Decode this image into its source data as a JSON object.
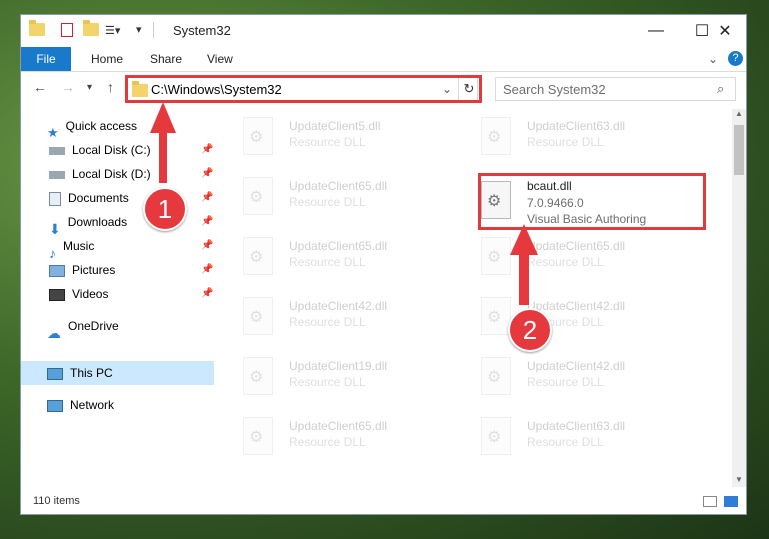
{
  "window": {
    "title": "System32"
  },
  "ribbon": {
    "tabs": [
      "File",
      "Home",
      "Share",
      "View"
    ]
  },
  "address": {
    "path": "C:\\Windows\\System32"
  },
  "search": {
    "placeholder": "Search System32"
  },
  "sidebar": {
    "quick_access": "Quick access",
    "items": [
      {
        "label": "Local Disk (C:)",
        "icon": "drive-icon"
      },
      {
        "label": "Local Disk (D:)",
        "icon": "drive-icon"
      },
      {
        "label": "Documents",
        "icon": "documents-icon"
      },
      {
        "label": "Downloads",
        "icon": "downloads-icon"
      },
      {
        "label": "Music",
        "icon": "music-icon"
      },
      {
        "label": "Pictures",
        "icon": "pictures-icon"
      },
      {
        "label": "Videos",
        "icon": "videos-icon"
      }
    ],
    "onedrive": "OneDrive",
    "this_pc": "This PC",
    "network": "Network"
  },
  "files": {
    "background": [
      {
        "name": "UpdateClient5.dll",
        "desc": "Resource DLL"
      },
      {
        "name": "UpdateClient65.dll",
        "desc": "Resource DLL"
      },
      {
        "name": "UpdateClient65.dll",
        "desc": "Resource DLL"
      },
      {
        "name": "UpdateClient42.dll",
        "desc": "Resource DLL"
      },
      {
        "name": "UpdateClient19.dll",
        "desc": "Resource DLL"
      },
      {
        "name": "UpdateClient65.dll",
        "desc": "Resource DLL"
      },
      {
        "name": "UpdateClient63.dll",
        "desc": "Resource DLL"
      },
      {
        "name": "UpdateClient65.dll",
        "desc": "Resource DLL"
      },
      {
        "name": "UpdateClient42.dll",
        "desc": "Resource DLL"
      },
      {
        "name": "UpdateClient42.dll",
        "desc": "Resource DLL"
      },
      {
        "name": "UpdateClient63.dll",
        "desc": "Resource DLL"
      }
    ],
    "highlighted": {
      "name": "bcaut.dll",
      "version": "7.0.9466.0",
      "desc": "Visual Basic Authoring"
    }
  },
  "status": {
    "items": "110 items"
  },
  "callouts": {
    "one": "1",
    "two": "2"
  },
  "colors": {
    "accent": "#1979ca",
    "callout": "#e0393e",
    "selected": "#cce8ff"
  }
}
